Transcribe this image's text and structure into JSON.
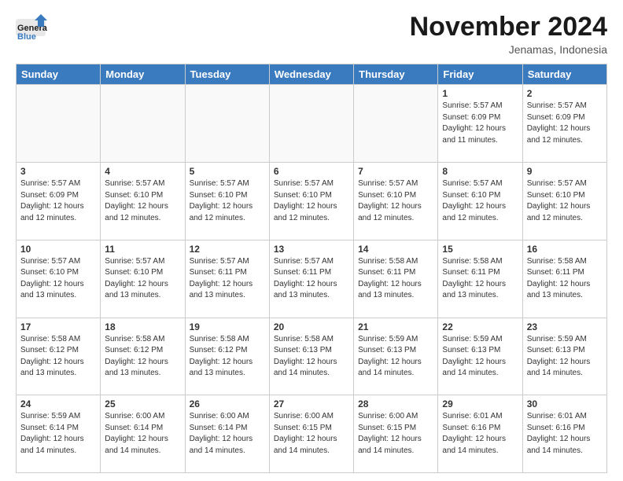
{
  "header": {
    "logo_line1": "General",
    "logo_line2": "Blue",
    "month": "November 2024",
    "location": "Jenamas, Indonesia"
  },
  "days_of_week": [
    "Sunday",
    "Monday",
    "Tuesday",
    "Wednesday",
    "Thursday",
    "Friday",
    "Saturday"
  ],
  "weeks": [
    [
      {
        "day": "",
        "sunrise": "",
        "sunset": "",
        "daylight": ""
      },
      {
        "day": "",
        "sunrise": "",
        "sunset": "",
        "daylight": ""
      },
      {
        "day": "",
        "sunrise": "",
        "sunset": "",
        "daylight": ""
      },
      {
        "day": "",
        "sunrise": "",
        "sunset": "",
        "daylight": ""
      },
      {
        "day": "",
        "sunrise": "",
        "sunset": "",
        "daylight": ""
      },
      {
        "day": "1",
        "sunrise": "Sunrise: 5:57 AM",
        "sunset": "Sunset: 6:09 PM",
        "daylight": "Daylight: 12 hours and 11 minutes."
      },
      {
        "day": "2",
        "sunrise": "Sunrise: 5:57 AM",
        "sunset": "Sunset: 6:09 PM",
        "daylight": "Daylight: 12 hours and 12 minutes."
      }
    ],
    [
      {
        "day": "3",
        "sunrise": "Sunrise: 5:57 AM",
        "sunset": "Sunset: 6:09 PM",
        "daylight": "Daylight: 12 hours and 12 minutes."
      },
      {
        "day": "4",
        "sunrise": "Sunrise: 5:57 AM",
        "sunset": "Sunset: 6:10 PM",
        "daylight": "Daylight: 12 hours and 12 minutes."
      },
      {
        "day": "5",
        "sunrise": "Sunrise: 5:57 AM",
        "sunset": "Sunset: 6:10 PM",
        "daylight": "Daylight: 12 hours and 12 minutes."
      },
      {
        "day": "6",
        "sunrise": "Sunrise: 5:57 AM",
        "sunset": "Sunset: 6:10 PM",
        "daylight": "Daylight: 12 hours and 12 minutes."
      },
      {
        "day": "7",
        "sunrise": "Sunrise: 5:57 AM",
        "sunset": "Sunset: 6:10 PM",
        "daylight": "Daylight: 12 hours and 12 minutes."
      },
      {
        "day": "8",
        "sunrise": "Sunrise: 5:57 AM",
        "sunset": "Sunset: 6:10 PM",
        "daylight": "Daylight: 12 hours and 12 minutes."
      },
      {
        "day": "9",
        "sunrise": "Sunrise: 5:57 AM",
        "sunset": "Sunset: 6:10 PM",
        "daylight": "Daylight: 12 hours and 12 minutes."
      }
    ],
    [
      {
        "day": "10",
        "sunrise": "Sunrise: 5:57 AM",
        "sunset": "Sunset: 6:10 PM",
        "daylight": "Daylight: 12 hours and 13 minutes."
      },
      {
        "day": "11",
        "sunrise": "Sunrise: 5:57 AM",
        "sunset": "Sunset: 6:10 PM",
        "daylight": "Daylight: 12 hours and 13 minutes."
      },
      {
        "day": "12",
        "sunrise": "Sunrise: 5:57 AM",
        "sunset": "Sunset: 6:11 PM",
        "daylight": "Daylight: 12 hours and 13 minutes."
      },
      {
        "day": "13",
        "sunrise": "Sunrise: 5:57 AM",
        "sunset": "Sunset: 6:11 PM",
        "daylight": "Daylight: 12 hours and 13 minutes."
      },
      {
        "day": "14",
        "sunrise": "Sunrise: 5:58 AM",
        "sunset": "Sunset: 6:11 PM",
        "daylight": "Daylight: 12 hours and 13 minutes."
      },
      {
        "day": "15",
        "sunrise": "Sunrise: 5:58 AM",
        "sunset": "Sunset: 6:11 PM",
        "daylight": "Daylight: 12 hours and 13 minutes."
      },
      {
        "day": "16",
        "sunrise": "Sunrise: 5:58 AM",
        "sunset": "Sunset: 6:11 PM",
        "daylight": "Daylight: 12 hours and 13 minutes."
      }
    ],
    [
      {
        "day": "17",
        "sunrise": "Sunrise: 5:58 AM",
        "sunset": "Sunset: 6:12 PM",
        "daylight": "Daylight: 12 hours and 13 minutes."
      },
      {
        "day": "18",
        "sunrise": "Sunrise: 5:58 AM",
        "sunset": "Sunset: 6:12 PM",
        "daylight": "Daylight: 12 hours and 13 minutes."
      },
      {
        "day": "19",
        "sunrise": "Sunrise: 5:58 AM",
        "sunset": "Sunset: 6:12 PM",
        "daylight": "Daylight: 12 hours and 13 minutes."
      },
      {
        "day": "20",
        "sunrise": "Sunrise: 5:58 AM",
        "sunset": "Sunset: 6:13 PM",
        "daylight": "Daylight: 12 hours and 14 minutes."
      },
      {
        "day": "21",
        "sunrise": "Sunrise: 5:59 AM",
        "sunset": "Sunset: 6:13 PM",
        "daylight": "Daylight: 12 hours and 14 minutes."
      },
      {
        "day": "22",
        "sunrise": "Sunrise: 5:59 AM",
        "sunset": "Sunset: 6:13 PM",
        "daylight": "Daylight: 12 hours and 14 minutes."
      },
      {
        "day": "23",
        "sunrise": "Sunrise: 5:59 AM",
        "sunset": "Sunset: 6:13 PM",
        "daylight": "Daylight: 12 hours and 14 minutes."
      }
    ],
    [
      {
        "day": "24",
        "sunrise": "Sunrise: 5:59 AM",
        "sunset": "Sunset: 6:14 PM",
        "daylight": "Daylight: 12 hours and 14 minutes."
      },
      {
        "day": "25",
        "sunrise": "Sunrise: 6:00 AM",
        "sunset": "Sunset: 6:14 PM",
        "daylight": "Daylight: 12 hours and 14 minutes."
      },
      {
        "day": "26",
        "sunrise": "Sunrise: 6:00 AM",
        "sunset": "Sunset: 6:14 PM",
        "daylight": "Daylight: 12 hours and 14 minutes."
      },
      {
        "day": "27",
        "sunrise": "Sunrise: 6:00 AM",
        "sunset": "Sunset: 6:15 PM",
        "daylight": "Daylight: 12 hours and 14 minutes."
      },
      {
        "day": "28",
        "sunrise": "Sunrise: 6:00 AM",
        "sunset": "Sunset: 6:15 PM",
        "daylight": "Daylight: 12 hours and 14 minutes."
      },
      {
        "day": "29",
        "sunrise": "Sunrise: 6:01 AM",
        "sunset": "Sunset: 6:16 PM",
        "daylight": "Daylight: 12 hours and 14 minutes."
      },
      {
        "day": "30",
        "sunrise": "Sunrise: 6:01 AM",
        "sunset": "Sunset: 6:16 PM",
        "daylight": "Daylight: 12 hours and 14 minutes."
      }
    ]
  ]
}
